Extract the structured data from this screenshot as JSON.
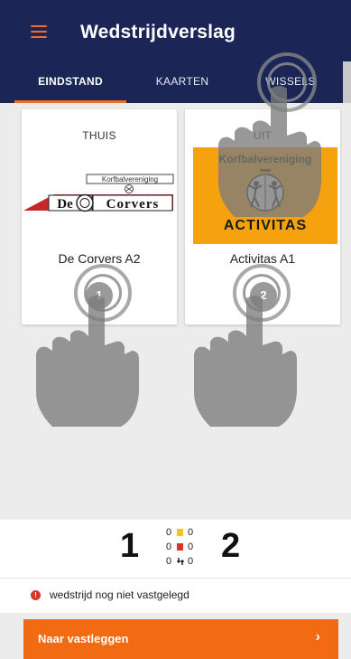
{
  "header": {
    "title": "Wedstrijdverslag",
    "menu_icon": "hamburger-menu-icon"
  },
  "tabs": [
    {
      "label": "EINDSTAND",
      "active": true
    },
    {
      "label": "KAARTEN",
      "active": false
    },
    {
      "label": "WISSELS",
      "active": false
    }
  ],
  "home": {
    "side_label": "THUIS",
    "logo_top_text": "Korfbalvereniging",
    "logo_text_de": "De",
    "logo_text_corvers": "Corvers",
    "team_name": "De Corvers A2",
    "score": "1"
  },
  "away": {
    "side_label": "UIT",
    "logo_top_text": "Korfbalvereniging",
    "logo_bottom_text": "ACTIVITAS",
    "team_name": "Activitas A1",
    "score": "2"
  },
  "summary": {
    "home_score": "1",
    "away_score": "2",
    "yellow": {
      "home": "0",
      "away": "0"
    },
    "red": {
      "home": "0",
      "away": "0"
    },
    "subs": {
      "home": "0",
      "away": "0"
    }
  },
  "status": {
    "message": "wedstrijd nog niet vastgelegd"
  },
  "cta": {
    "label": "Naar vastleggen",
    "chevron": "›"
  },
  "colors": {
    "header_bg": "#1b2657",
    "accent": "#f06a2a",
    "cta_bg": "#f26a12",
    "error": "#d9342b",
    "away_logo_bg": "#f6a20f"
  }
}
